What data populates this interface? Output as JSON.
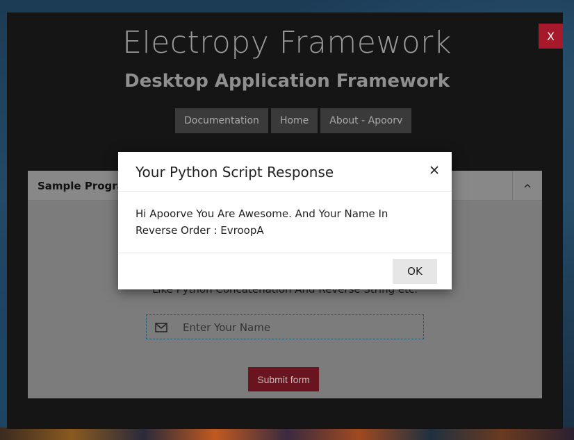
{
  "window": {
    "close_label": "X",
    "title": "Electropy Framework",
    "subtitle": "Desktop Application Framework"
  },
  "nav": {
    "items": [
      {
        "label": "Documentation"
      },
      {
        "label": "Home"
      },
      {
        "label": "About - Apoorv"
      }
    ]
  },
  "panel": {
    "title": "Sample Program",
    "toggle_icon": "chevron-up-icon",
    "description": "Like Python Concatenation And Reverse String etc.",
    "name_input": {
      "placeholder": "Enter Your Name",
      "value": "",
      "icon": "envelope-icon"
    },
    "submit_label": "Submit form"
  },
  "modal": {
    "title": "Your Python Script Response",
    "close_icon": "close-icon",
    "message": "Hi Apoorve You Are Awesome. And Your Name In Reverse Order : EvroopA",
    "ok_label": "OK"
  }
}
